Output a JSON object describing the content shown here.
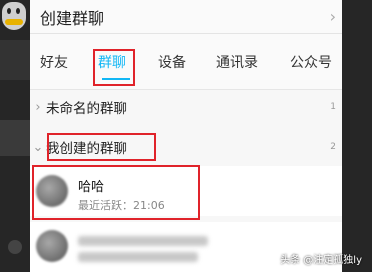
{
  "header": {
    "title": "创建群聊"
  },
  "tabs": [
    {
      "label": "好友"
    },
    {
      "label": "群聊"
    },
    {
      "label": "设备"
    },
    {
      "label": "通讯录"
    },
    {
      "label": "公众号"
    }
  ],
  "groups": [
    {
      "label": "未命名的群聊",
      "count": "1"
    },
    {
      "label": "我创建的群聊",
      "count": "2"
    }
  ],
  "chats": [
    {
      "name": "哈哈",
      "status": "最近活跃：21:06"
    }
  ],
  "watermark": "头条 @注定孤独ly",
  "colors": {
    "accent": "#12b7f5",
    "highlight_box": "#e0232a"
  }
}
